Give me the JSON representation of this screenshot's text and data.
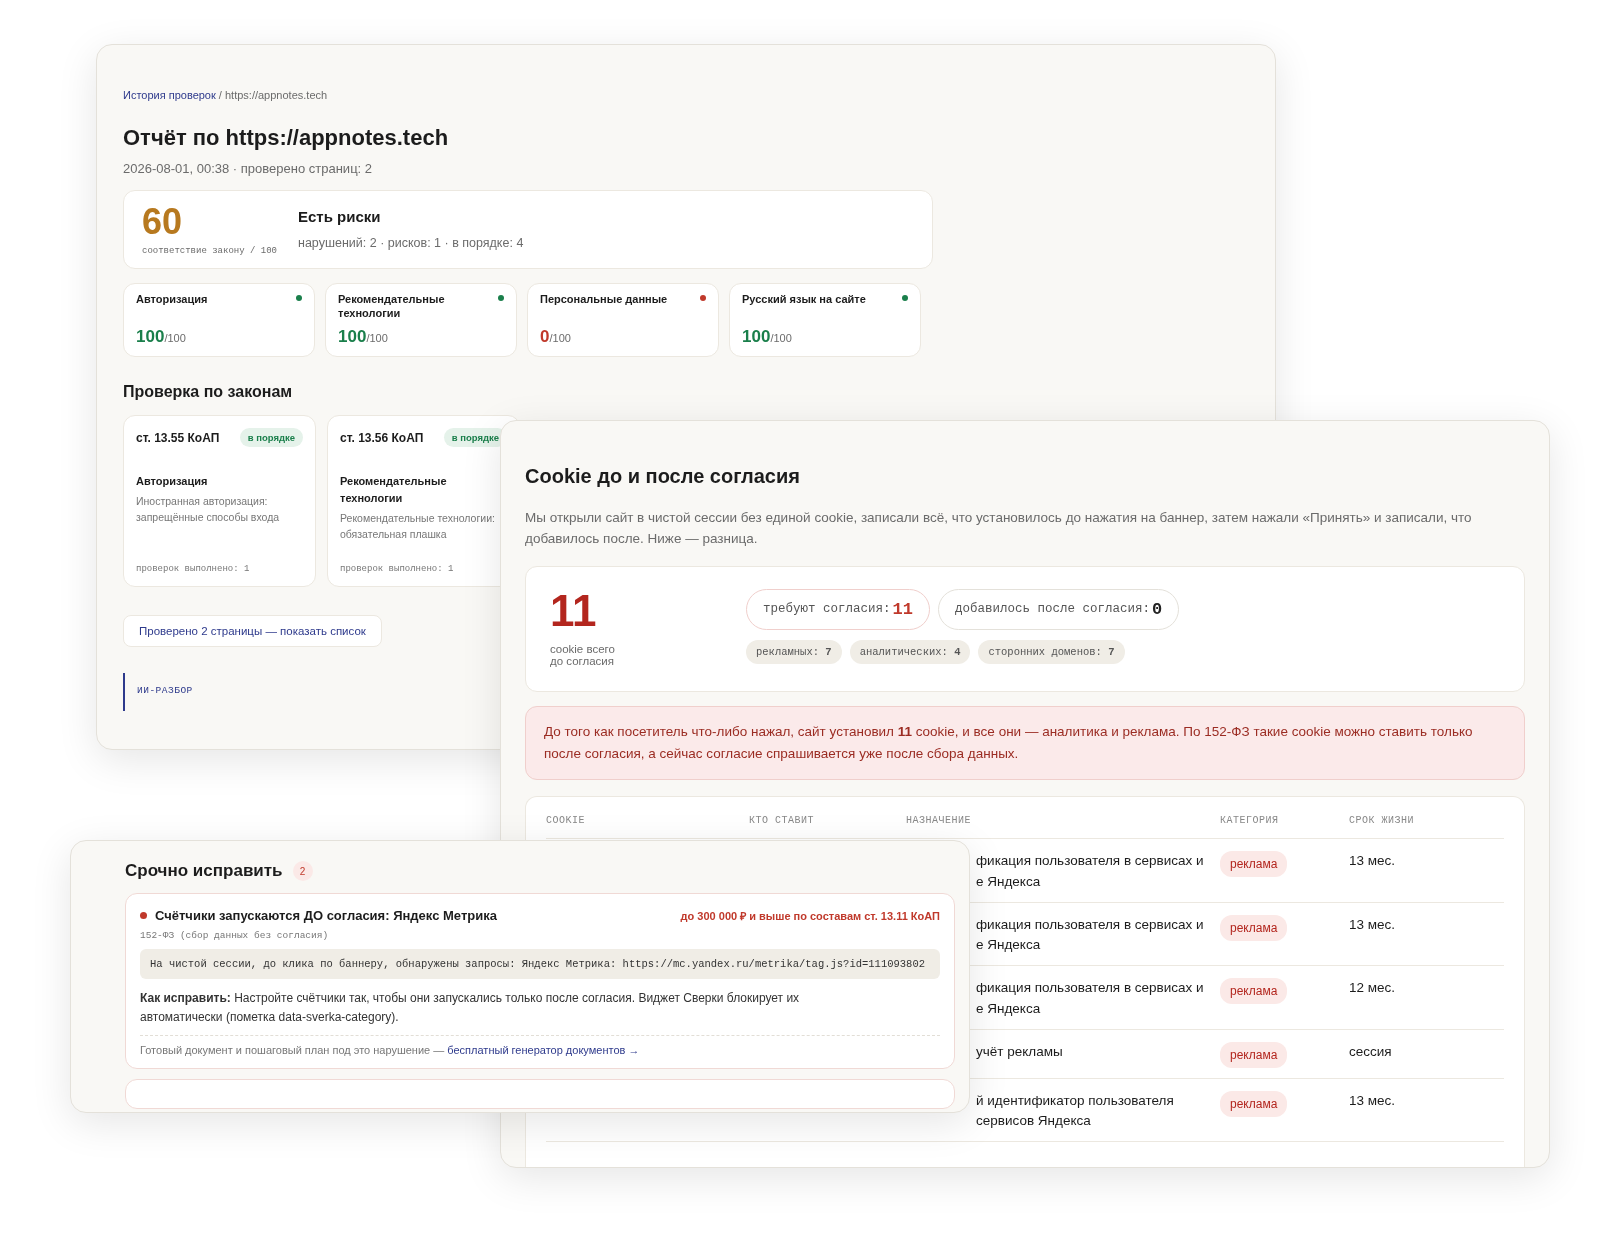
{
  "report": {
    "breadcrumb": {
      "link": "История проверок",
      "separator": "/",
      "current": "https://appnotes.tech"
    },
    "title": "Отчёт по https://appnotes.tech",
    "meta": "2026-08-01, 00:38 · проверено страниц: 2",
    "score": {
      "value": "60",
      "caption": "соответствие закону / 100",
      "verdict": "Есть риски",
      "summary": "нарушений: 2 · рисков: 1 · в порядке: 4"
    },
    "categories": [
      {
        "name": "Авторизация",
        "score": "100",
        "max": "/100",
        "color": "#1a7f4b"
      },
      {
        "name": "Рекомендательные технологии",
        "score": "100",
        "max": "/100",
        "color": "#1a7f4b"
      },
      {
        "name": "Персональные данные",
        "score": "0",
        "max": "/100",
        "color": "#c0392b"
      },
      {
        "name": "Русский язык на сайте",
        "score": "100",
        "max": "/100",
        "color": "#1a7f4b"
      }
    ],
    "laws_title": "Проверка по законам",
    "laws": [
      {
        "article": "ст. 13.55 КоАП",
        "badge": "в порядке",
        "kind": "ok",
        "topic": "Авторизация",
        "description": "Иностранная авторизация: запрещённые способы входа",
        "checks": "проверок выполнено: 1"
      },
      {
        "article": "ст. 13.56 КоАП",
        "badge": "в порядке",
        "kind": "ok",
        "topic": "Рекомендательные технологии",
        "description": "Рекомендательные технологии: обязательная плашка",
        "checks": "проверок выполнено: 1"
      }
    ],
    "pages_button": "Проверено 2 страницы — показать список",
    "ai_label": "ИИ-РАЗБОР"
  },
  "cookies": {
    "title": "Cookie до и после согласия",
    "description": "Мы открыли сайт в чистой сессии без единой cookie, записали всё, что установилось до нажатия на баннер, затем нажали «Принять» и записали, что добавилось после. Ниже — разница.",
    "total": {
      "value": "11",
      "caption": "cookie всего\nдо согласия"
    },
    "pills": [
      {
        "label": "требуют согласия:",
        "value": "11",
        "kind": "alert"
      },
      {
        "label": "добавилось после согласия:",
        "value": "0",
        "kind": "neutral"
      }
    ],
    "tags": [
      {
        "label": "рекламных:",
        "value": "7"
      },
      {
        "label": "аналитических:",
        "value": "4"
      },
      {
        "label": "сторонних доменов:",
        "value": "7"
      }
    ],
    "alert": "До того как посетитель что-либо нажал, сайт установил **11** cookie, и все они — аналитика и реклама. По 152-ФЗ такие cookie можно ставить только после согласия, а сейчас согласие спрашивается уже после сбора данных.",
    "table": {
      "columns": [
        "COOKIE",
        "КТО СТАВИТ",
        "НАЗНАЧЕНИЕ",
        "КАТЕГОРИЯ",
        "СРОК ЖИЗНИ"
      ],
      "rows": [
        {
          "purpose": "фикация пользователя в сервисах и\nе Яндекса",
          "category": "реклама",
          "lifetime": "13 мес."
        },
        {
          "purpose": "фикация пользователя в сервисах и\nе Яндекса",
          "category": "реклама",
          "lifetime": "13 мес."
        },
        {
          "purpose": "фикация пользователя в сервисах и\nе Яндекса",
          "category": "реклама",
          "lifetime": "12 мес."
        },
        {
          "purpose": "учёт рекламы",
          "category": "реклама",
          "lifetime": "сессия"
        },
        {
          "purpose": "й идентификатор пользователя\nсервисов Яндекса",
          "category": "реклама",
          "lifetime": "13 мес."
        }
      ]
    }
  },
  "urgent": {
    "title": "Срочно исправить",
    "count": "2",
    "issues": [
      {
        "color": "#c0392b",
        "title": "Счётчики запускаются ДО согласия: Яндекс Метрика",
        "fine": "до 300 000 ₽ и выше по составам ст. 13.11 КоАП",
        "law": "152-ФЗ (сбор данных без согласия)",
        "evidence": "На чистой сессии, до клика по баннеру, обнаружены запросы: Яндекс Метрика: https://mc.yandex.ru/metrika/tag.js?id=111093802",
        "fix": "**Как исправить:** Настройте счётчики так, чтобы они запускались только после согласия. Виджет Сверки блокирует их автоматически (пометка data-sverka-category).",
        "footer": "Готовый документ и пошаговый план под это нарушение — ",
        "footer_link": "бесплатный генератор документов →"
      }
    ]
  }
}
